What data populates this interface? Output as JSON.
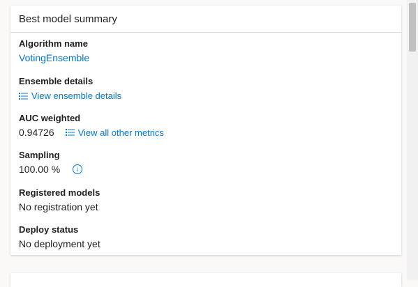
{
  "card": {
    "title": "Best model summary",
    "fields": [
      {
        "label": "Algorithm name",
        "value": "VotingEnsemble"
      },
      {
        "label": "Ensemble details",
        "link": "View ensemble details"
      },
      {
        "label": "AUC weighted",
        "value": "0.94726",
        "link": "View all other metrics"
      },
      {
        "label": "Sampling",
        "value": "100.00 %"
      },
      {
        "label": "Registered models",
        "value": "No registration yet"
      },
      {
        "label": "Deploy status",
        "value": "No deployment yet"
      }
    ]
  },
  "colors": {
    "accent": "#0078d4",
    "text": "#201f1e",
    "background": "#faf9f8"
  },
  "icons": {
    "list": "list-icon",
    "info": "info-icon"
  }
}
